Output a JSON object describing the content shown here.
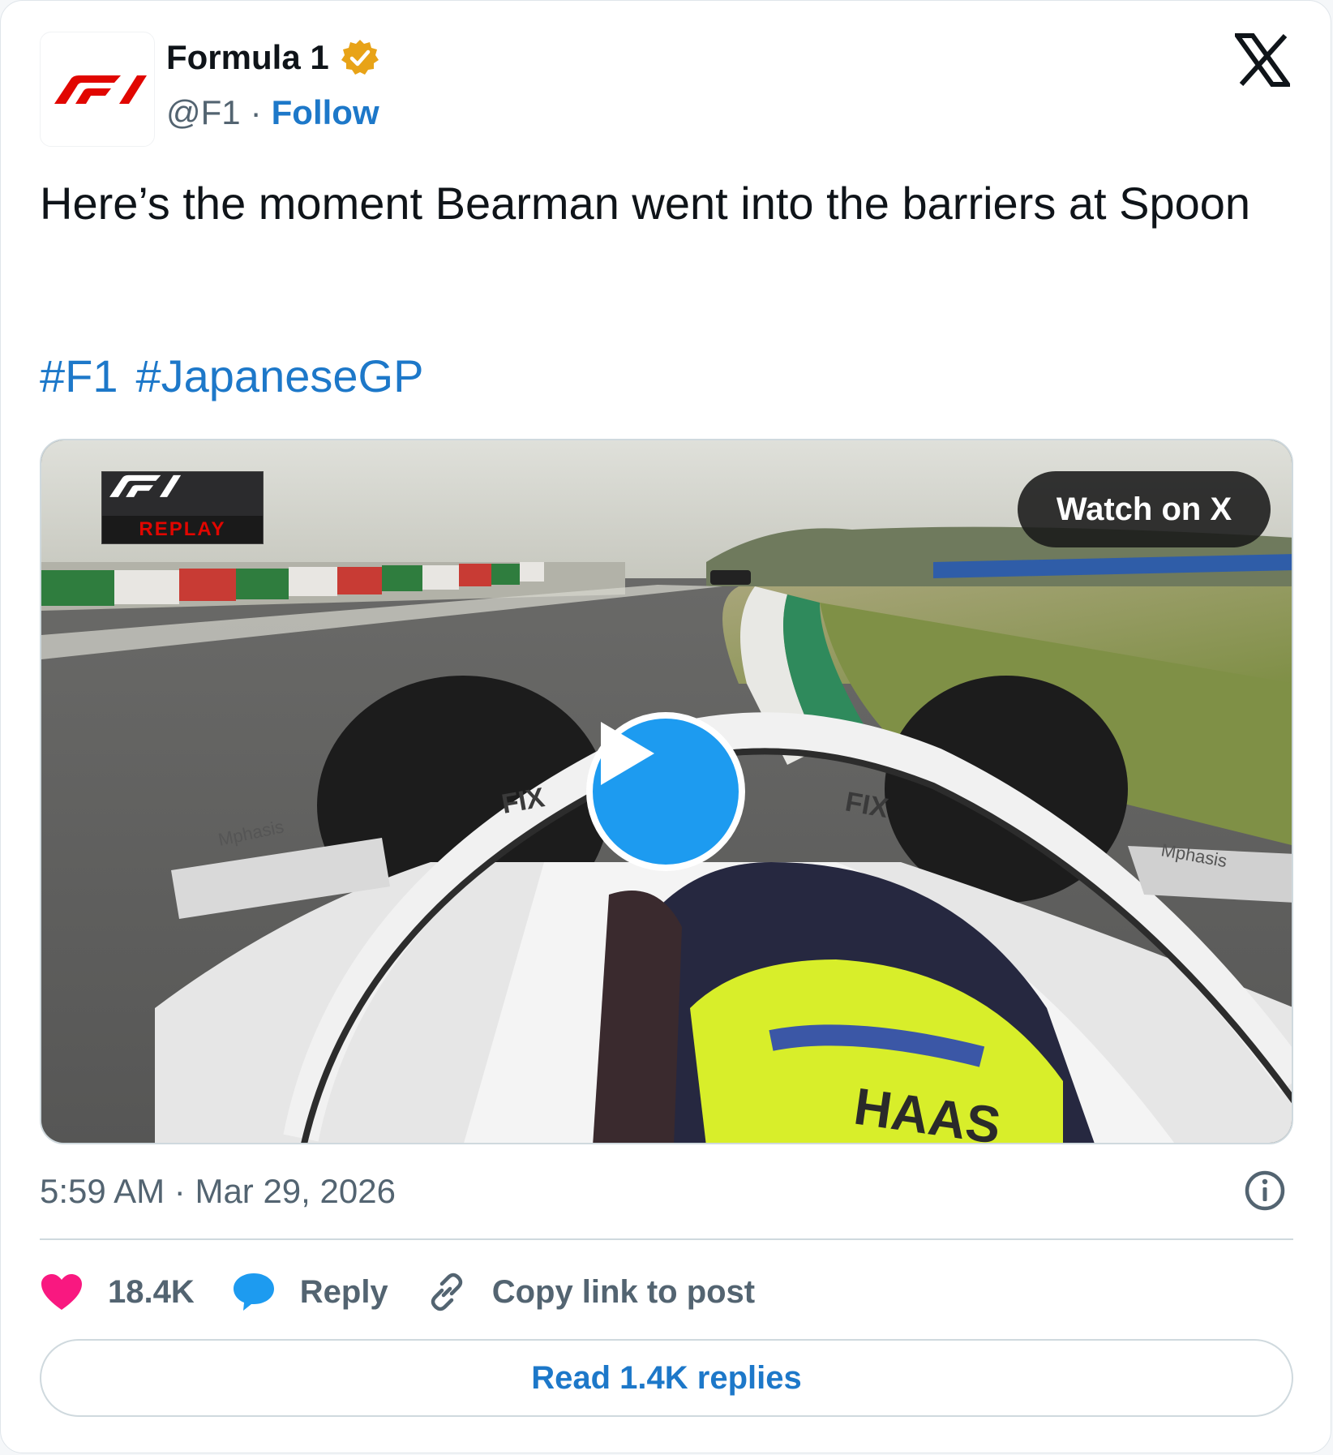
{
  "author": {
    "name": "Formula 1",
    "handle": "@F1",
    "separator": "·",
    "follow_label": "Follow",
    "verified": true,
    "avatar_icon": "f1-logo-icon"
  },
  "tweet": {
    "text": "Here’s the moment Bearman went into the barriers at Spoon",
    "hashtags": [
      "#F1",
      "#JapaneseGP"
    ]
  },
  "media": {
    "overlay_badge": "REPLAY",
    "watch_button": "Watch on X",
    "play_icon": "play-icon"
  },
  "meta": {
    "time": "5:59 AM",
    "separator": "·",
    "date": "Mar 29, 2026"
  },
  "actions": {
    "likes": "18.4K",
    "reply_label": "Reply",
    "copy_link_label": "Copy link to post"
  },
  "read_replies": "Read 1.4K replies",
  "colors": {
    "link": "#1d78c9",
    "like": "#f91880",
    "reply": "#1d9bf0",
    "verified": "#e8a317",
    "f1_red": "#e10600"
  }
}
